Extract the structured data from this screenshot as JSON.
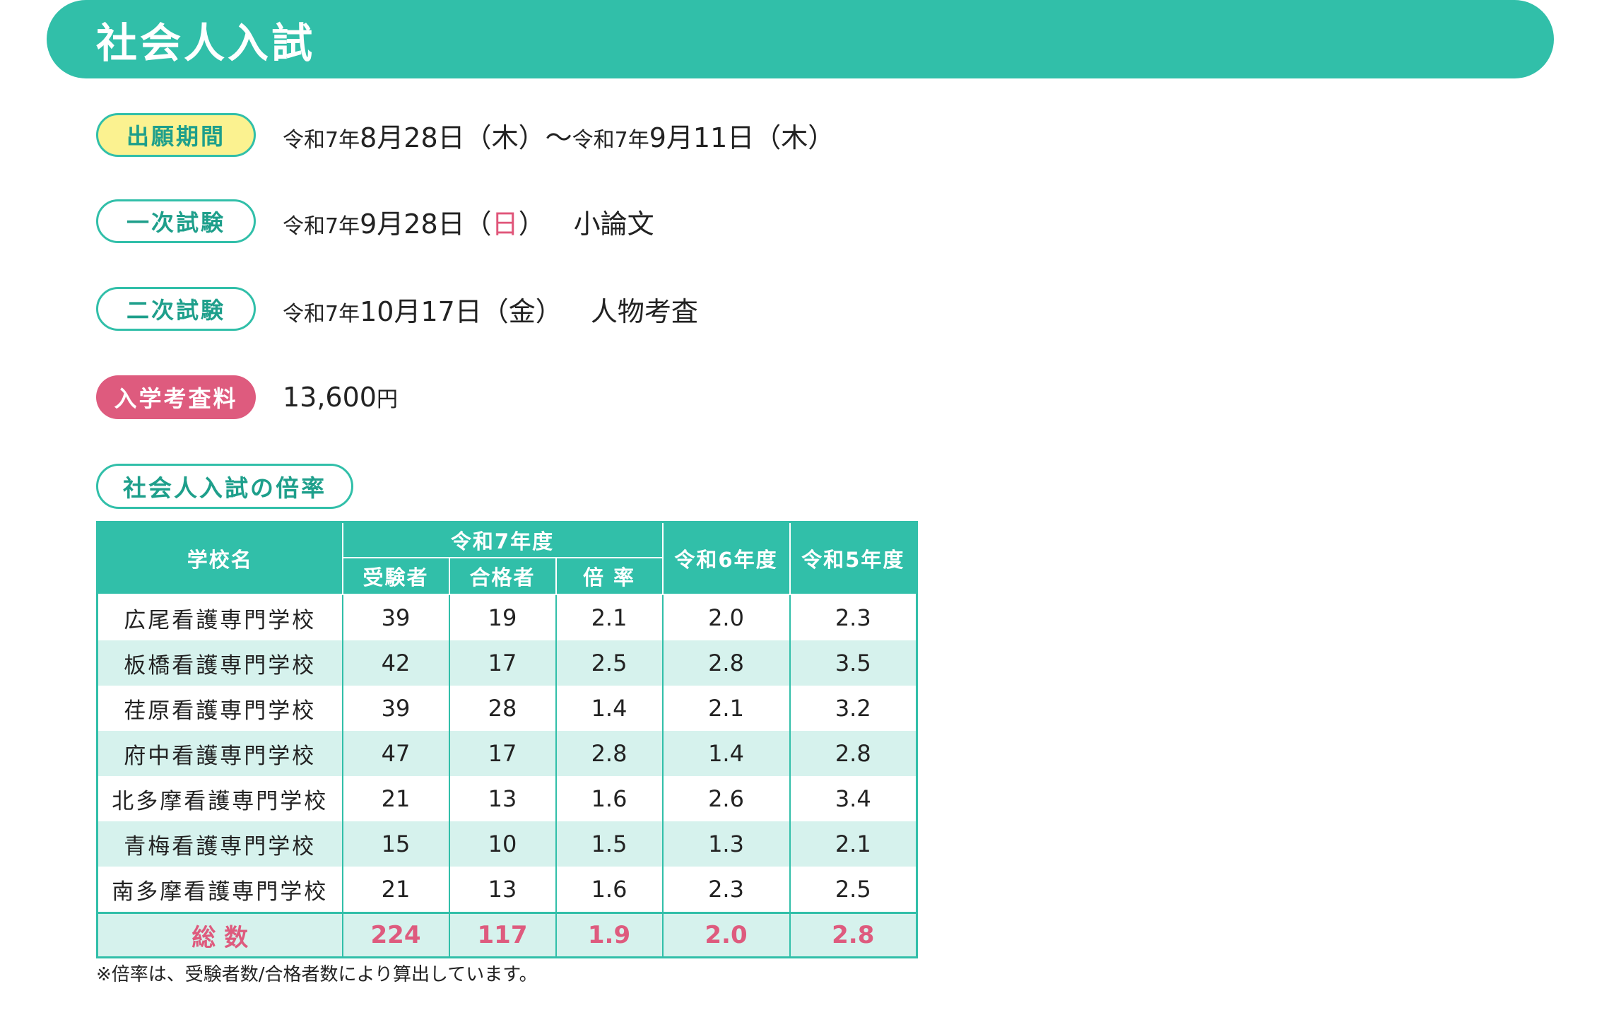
{
  "header": {
    "title": "社会人入試"
  },
  "info": {
    "application": {
      "label": "出願期間",
      "text_a": "令和7年",
      "text_b": "8月28日（木）〜",
      "text_c": "令和7年",
      "text_d": "9月11日（木）"
    },
    "first_exam": {
      "label": "一次試験",
      "text_a": "令和7年",
      "text_b": "9月28日（",
      "text_day": "日",
      "text_c": "）",
      "subject": "小論文"
    },
    "second_exam": {
      "label": "二次試験",
      "text_a": "令和7年",
      "text_b": "10月17日（金）",
      "subject": "人物考査"
    },
    "fee": {
      "label": "入学考査料",
      "amount": "13,600",
      "unit": "円"
    }
  },
  "rate_section": {
    "title": "社会人入試の倍率"
  },
  "table": {
    "headers": {
      "school": "学校名",
      "r7": "令和7年度",
      "examinees": "受験者",
      "passed": "合格者",
      "ratio": "倍 率",
      "r6": "令和6年度",
      "r5": "令和5年度"
    },
    "rows": [
      {
        "school": "広尾看護専門学校",
        "examinees": "39",
        "passed": "19",
        "ratio": "2.1",
        "r6": "2.0",
        "r5": "2.3"
      },
      {
        "school": "板橋看護専門学校",
        "examinees": "42",
        "passed": "17",
        "ratio": "2.5",
        "r6": "2.8",
        "r5": "3.5"
      },
      {
        "school": "荏原看護専門学校",
        "examinees": "39",
        "passed": "28",
        "ratio": "1.4",
        "r6": "2.1",
        "r5": "3.2"
      },
      {
        "school": "府中看護専門学校",
        "examinees": "47",
        "passed": "17",
        "ratio": "2.8",
        "r6": "1.4",
        "r5": "2.8"
      },
      {
        "school": "北多摩看護専門学校",
        "examinees": "21",
        "passed": "13",
        "ratio": "1.6",
        "r6": "2.6",
        "r5": "3.4"
      },
      {
        "school": "青梅看護専門学校",
        "examinees": "15",
        "passed": "10",
        "ratio": "1.5",
        "r6": "1.3",
        "r5": "2.1"
      },
      {
        "school": "南多摩看護専門学校",
        "examinees": "21",
        "passed": "13",
        "ratio": "1.6",
        "r6": "2.3",
        "r5": "2.5"
      }
    ],
    "total": {
      "label": "総 数",
      "examinees": "224",
      "passed": "117",
      "ratio": "1.9",
      "r6": "2.0",
      "r5": "2.8"
    }
  },
  "note": "※倍率は、受験者数/合格者数により算出しています。"
}
